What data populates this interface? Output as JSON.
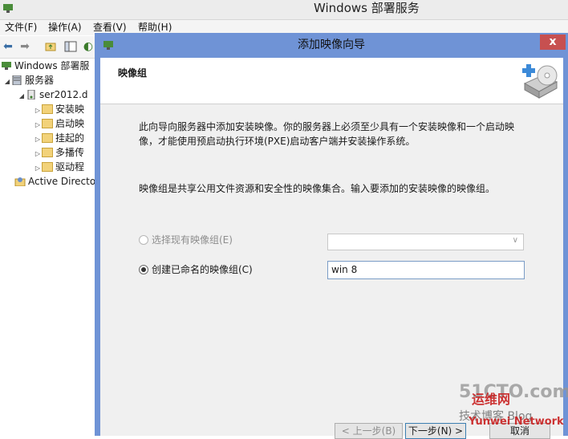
{
  "main_window": {
    "title": "Windows 部署服务"
  },
  "menu": [
    {
      "label": "文件(F)"
    },
    {
      "label": "操作(A)"
    },
    {
      "label": "查看(V)"
    },
    {
      "label": "帮助(H)"
    }
  ],
  "tree": {
    "root": "Windows 部署服",
    "servers": "服务器",
    "server": "ser2012.d",
    "children": [
      "安装映",
      "启动映",
      "挂起的",
      "多播传",
      "驱动程"
    ],
    "ad": "Active Directo"
  },
  "wizard": {
    "title": "添加映像向导",
    "close": "x",
    "header_title": "映像组",
    "intro_text": "此向导向服务器中添加安装映像。你的服务器上必须至少具有一个安装映像和一个启动映像，才能使用预启动执行环境(PXE)启动客户端并安装操作系统。",
    "info_text": "映像组是共享公用文件资源和安全性的映像集合。输入要添加的安装映像的映像组。",
    "option_existing": {
      "label": "选择现有映像组(E)",
      "selected": false,
      "enabled": false
    },
    "option_create": {
      "label": "创建已命名的映像组(C)",
      "selected": true,
      "enabled": true
    },
    "image_group_value": "win 8",
    "buttons": {
      "back": "< 上一步(B)",
      "next": "下一步(N) >",
      "cancel": "取消"
    }
  },
  "watermark": {
    "line1": "51CTO.com",
    "line2": "技术博客 Blog",
    "line3": "运维网",
    "line4": "Yunwei Network"
  },
  "colors": {
    "wizard_frame": "#6f93d6",
    "close_button": "#c75050",
    "body_bg": "#f0f0f0"
  }
}
